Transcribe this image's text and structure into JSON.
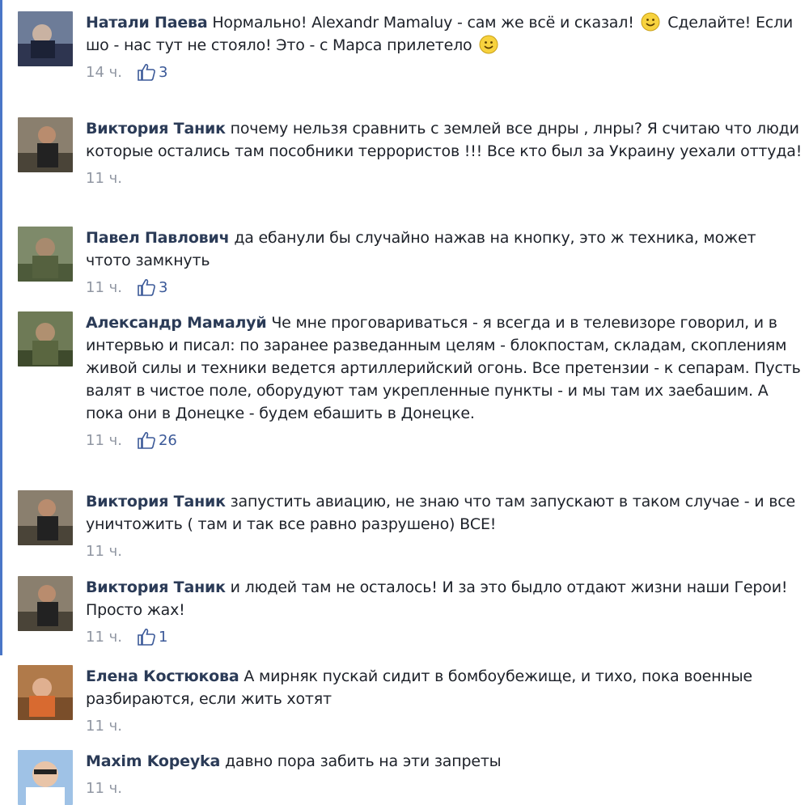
{
  "comments": [
    {
      "author": "Натали Паева",
      "text": "Нормально! Alexandr Mamaluy - сам же всё и сказал!",
      "text_after_emoji": "Сделайте! Если шо - нас тут не стояло! Это - с Марса прилетело",
      "time": "14 ч.",
      "likes": "3"
    },
    {
      "author": "Виктория Таник",
      "text": "почему нельзя сравнить с землей все днры , лнры? Я считаю что люди которые остались там пособники террористов !!! Все кто был за Украину уехали оттуда!",
      "time": "11 ч."
    },
    {
      "author": "Павел Павлович",
      "text": "да ебанули бы случайно нажав на кнопку, это ж техника, может чтото замкнуть",
      "time": "11 ч.",
      "likes": "3"
    },
    {
      "author": "Александр Мамалуй",
      "text": "Че мне проговариваться - я всегда и в телевизоре говорил, и в интервью и писал: по заранее разведанным целям - блокпостам, складам, скоплениям живой силы и техники ведется артиллерийский огонь. Все претензии - к сепарам. Пусть валят в чистое поле, оборудуют там укрепленные пункты - и мы там их заебашим. А пока они в Донецке - будем ебашить в Донецке.",
      "time": "11 ч.",
      "likes": "26"
    },
    {
      "author": "Виктория Таник",
      "text": "запустить авиацию, не знаю что там запускают в таком случае - и все уничтожить ( там и так все равно разрушено) ВСЕ!",
      "time": "11 ч."
    },
    {
      "author": "Виктория Таник",
      "text": "и людей там не осталось! И за это быдло отдают жизни наши Герои! Просто жах!",
      "time": "11 ч.",
      "likes": "1"
    },
    {
      "author": "Елена Костюкова",
      "text": "А мирняк пускай сидит в бомбоубежище, и тихо, пока военные разбираются, если жить хотят",
      "time": "11 ч."
    },
    {
      "author": "Maxim Kopeyka",
      "text": "давно пора забить на эти запреты",
      "time": "11 ч."
    }
  ],
  "colors": {
    "author": "#2b3b57",
    "meta": "#9197a3",
    "like": "#3b5998"
  },
  "icons": {
    "like": "thumbs-up-icon",
    "emoji": "smile-emoji-icon"
  }
}
